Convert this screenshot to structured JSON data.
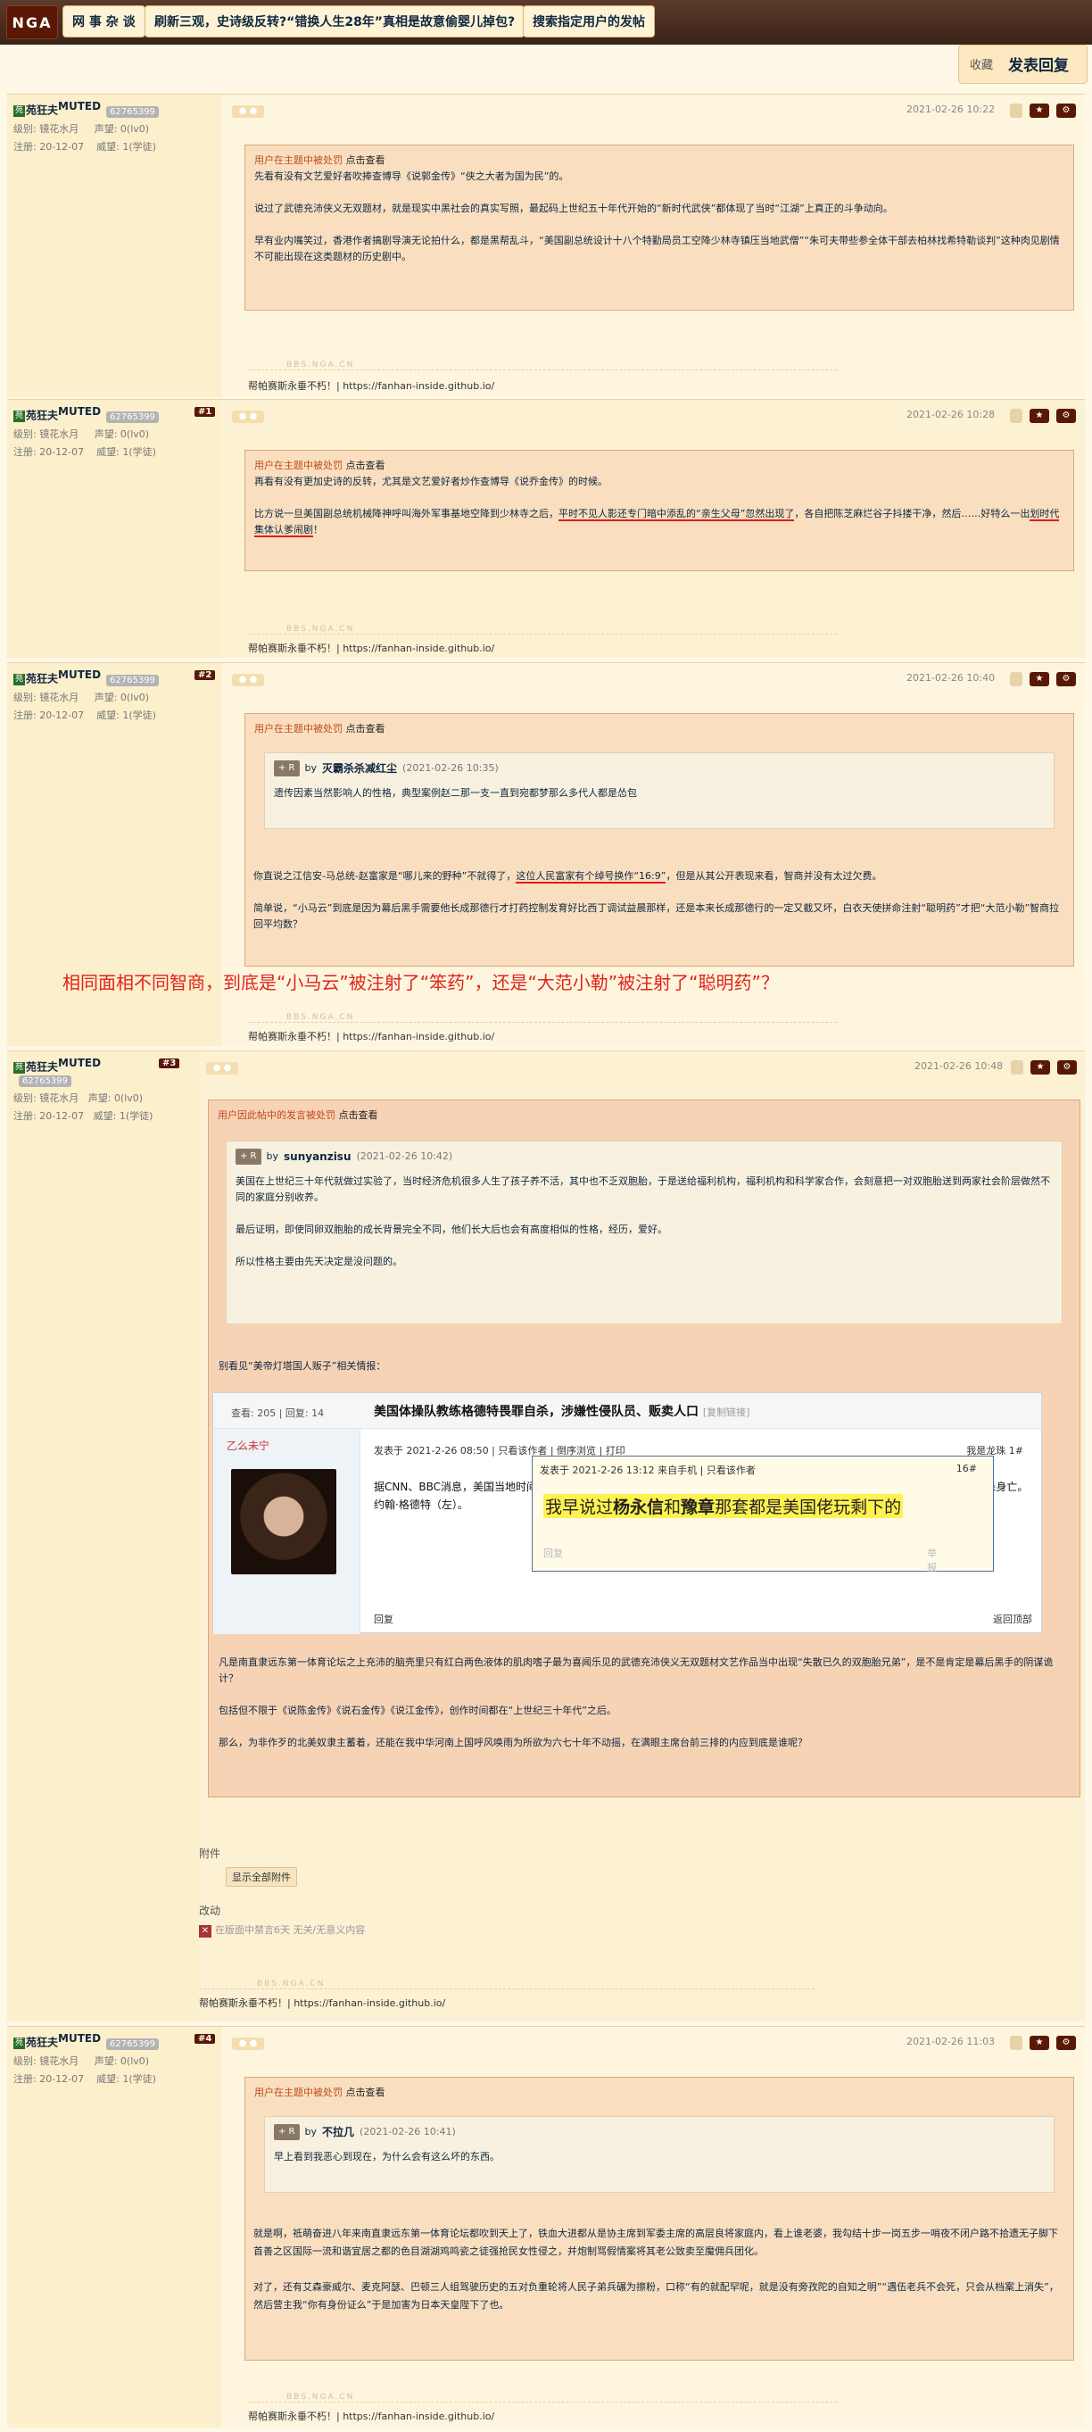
{
  "nav": {
    "logo": "NGA",
    "forum": "网 事 杂 谈",
    "thread": "刷新三观，史诗级反转?“错换人生28年”真相是故意偷婴儿掉包?",
    "search": "搜索指定用户的发帖"
  },
  "actions": {
    "fav": "收藏",
    "reply": "发表回复"
  },
  "signature": "帮帕赛斯永垂不朽！| https://fanhan-inside.github.io/",
  "watermark": "BBS.NGA.CN",
  "user": {
    "name": "MUTED",
    "prefix": "苑狂夫",
    "uid": "62765399",
    "level_label": "级别:",
    "level": "镜花水月",
    "rep_label": "声望:",
    "rep": "0(lv0)",
    "reg_label": "注册:",
    "reg": "20-12-07",
    "wei_label": "威望:",
    "wei": "1(学徒)"
  },
  "posts": [
    {
      "floor": "",
      "date": "2021-02-26 10:22",
      "hidden": "用户在主题中被处罚",
      "click": "点击查看",
      "p1": "先看有没有文艺爱好者吹捧查博导《说郭金传》“侠之大者为国为民”的。",
      "p2": "说过了武德充沛侠义无双题材，就是现实中黑社会的真实写照，最起码上世纪五十年代开始的“新时代武侠”都体现了当时“江湖”上真正的斗争动向。",
      "p3": "早有业内嘴笑过，香港作者搞剧导演无论拍什么，都是黑帮乱斗，“美国副总统设计十八个特勤局员工空降少林寺镇压当地武僧”“朱可夫带些参全体干部去柏林找希特勒谈判”这种肉见剧情不可能出现在这类题材的历史剧中。"
    },
    {
      "floor": "#1",
      "date": "2021-02-26 10:28",
      "hidden": "用户在主题中被处罚",
      "click": "点击查看",
      "p1": "再看有没有更加史诗的反转，尤其是文艺爱好者炒作查博导《说乔金传》的时候。",
      "p2a": "比方说一旦美国副总统机械降神呼叫海外军事基地空降到少林寺之后，",
      "p2b": "平时不见人影还专门暗中添乱的“亲生父母”忽然出现了",
      "p2c": "，各自把陈芝麻烂谷子抖搂干净，然后……好特么一出",
      "p2d": "划时代集体认爹闹剧",
      "p2e": "！"
    },
    {
      "floor": "#2",
      "date": "2021-02-26 10:40",
      "hidden": "用户在主题中被处罚",
      "click": "点击查看",
      "q_by": "by",
      "q_user": "灭霸杀杀减红尘",
      "q_date": "(2021-02-26 10:35)",
      "q_text": "遗传因素当然影响人的性格，典型案例赵二那一支一直到宛都梦那么多代人都是怂包",
      "p1a": "你直说之江信安-马总统-赵富家是“哪儿来的野种”不就得了，",
      "p1b": "这位人民富家有个绰号换作“16:9”",
      "p1c": "，但是从其公开表现来看，智商并没有太过欠费。",
      "p2": "简单说，“小马云”到底是因为幕后黑手需要他长成那德行才打药控制发育好比西丁调试益晨那样，还是本来长成那德行的一定又截又坏，白衣天使拼命注射“聪明药”才把“大范小勒”智商拉回平均数？",
      "banner": "相同面相不同智商，到底是“小马云”被注射了“笨药”，还是“大范小勒”被注射了“聪明药”？"
    },
    {
      "floor": "#3",
      "date": "2021-02-26 10:48",
      "hidden": "用户因此帖中的发言被处罚",
      "click": "点击查看",
      "q_by": "by",
      "q_user": "sunyanzisu",
      "q_date": "(2021-02-26 10:42)",
      "q_p1": "美国在上世纪三十年代就做过实验了，当时经济危机很多人生了孩子养不活，其中也不乏双胞胎，于是送给福利机构，福利机构和科学家合作，会刻意把一对双胞胎送到两家社会阶层做然不同的家庭分别收养。",
      "q_p2": "最后证明，即使同卵双胞胎的成长背景完全不同，他们长大后也会有高度相似的性格，经历，爱好。",
      "q_p3": "所以性格主要由先天决定是没问题的。",
      "p_intro": "别看见“美帝灯塔国人贩子”相关情报：",
      "p_after": "凡是南直隶远东第一体育论坛之上充沛的脑壳里只有红白两色液体的肌肉嗜子最为喜闻乐见的武德充沛侠义无双题材文艺作品当中出现“失散已久的双胞胎兄弟”，是不是肯定是幕后黑手的阴谋诡计？",
      "p_more": "包括但不限于《说陈金传》《说石金传》《说江金传》，创作时间都在“上世纪三十年代”之后。",
      "p_end": "那么，为非作歹的北美奴隶主蓄着，还能在我中华河南上国呼风唤雨为所欲为六七十年不动摇，在满眼主席台前三排的内应到底是谁呢？",
      "attach_label": "附件",
      "attach_btn": "显示全部附件",
      "edit_label": "改动",
      "edit_text": "在版面中禁言6天 无关/无意义内容"
    },
    {
      "floor": "#4",
      "date": "2021-02-26 11:03",
      "hidden": "用户在主题中被处罚",
      "click": "点击查看",
      "q_by": "by",
      "q_user": "不拉几",
      "q_date": "(2021-02-26 10:41)",
      "q_text": "早上看到我恶心到现在，为什么会有这么坏的东西。",
      "p1": "就是啊，祗萌奋进八年来南直隶远东第一体育论坛都吹到天上了，铁血大进都从是协主席到军委主席的高层良将家庭内，看上谁老婆，我勾结十步一岗五步一哨夜不闭户路不拾遗无子脚下首善之区国际一流和谐宜居之都的色目湖湖鸡鸣瓷之徒强抢民女性侵之，并炮制骂假情案将其老公致卖至魔佣兵团化。",
      "p2": "对了，还有艾森豪威尔、麦克阿瑟、巴顿三人组驾驶历史的五对负重轮将人民子弟兵碾为擦粉，口称“有的就配罕呢，就是没有旁孜陀的自知之明”“遇伍老兵不会死，只会从档案上消失”，然后营主我“你有身份证么”于是加害为日本天皇陛下了也。"
    }
  ],
  "shot": {
    "stats": "查看: 205 | 回复: 14",
    "title": "美国体操队教练格德特畏罪自杀，涉嫌性侵队员、贩卖人口",
    "title_link": "[复制链接]",
    "user": "乙么未宁",
    "meta": "发表于 2021-2-26 08:50 | 只看该作者 | 倒序浏览 | 打印",
    "floor": "我是龙珠 1#",
    "body": "据CNN、BBC消息，美国当地时间25日，前美国奥运体操教练约翰·格德特在受到贩卖人口和性犯罪等24项刑事指控后，被发现自杀身亡。",
    "caption": "约翰·格德特（左）。",
    "reply": "回复",
    "back": "返回顶部",
    "pop_meta": "发表于 2021-2-26 13:12 来自手机 | 只看该作者",
    "pop_floor": "16#",
    "pop_a": "我早说过",
    "pop_b": "杨永信",
    "pop_c": "和",
    "pop_d": "豫章",
    "pop_e": "那套都是美国佬玩剩下的",
    "pop_ft": "回复",
    "pop_ft2": "举报"
  }
}
